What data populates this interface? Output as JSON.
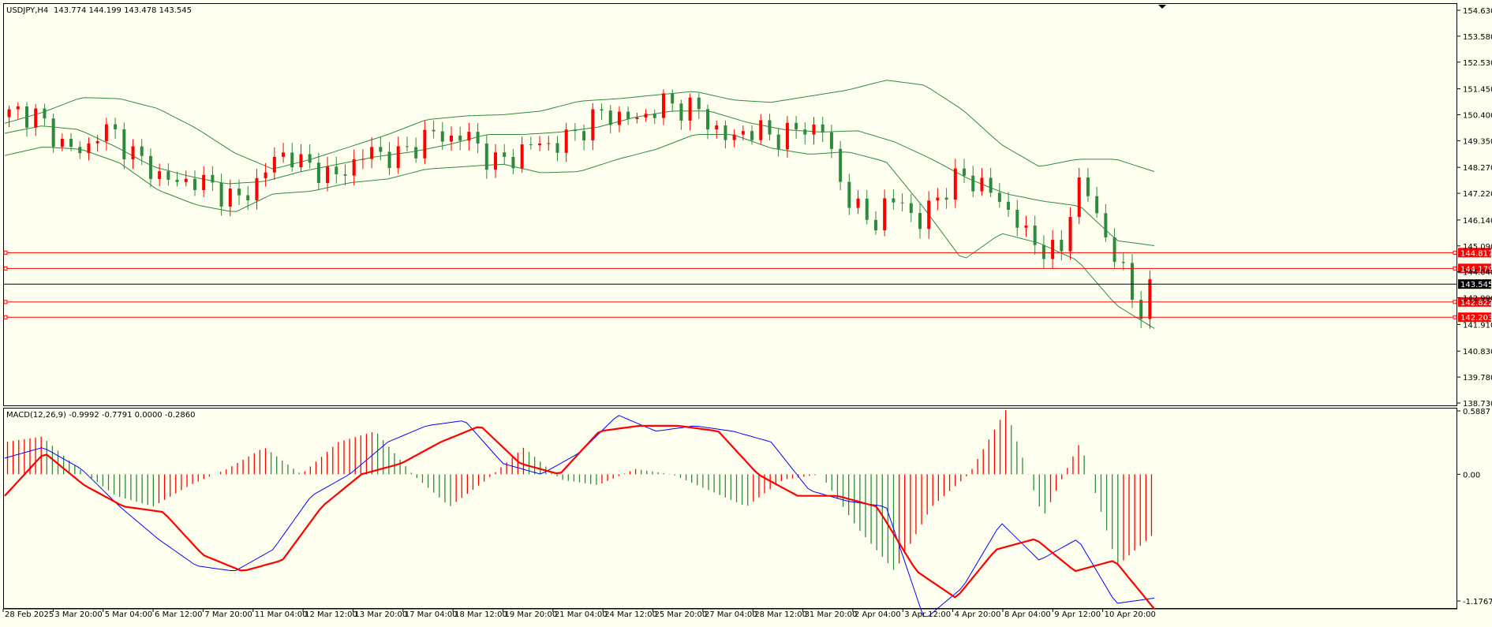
{
  "header": {
    "symbol": "USDJPY,H4",
    "ohlc": "143.774 144.199 143.478 143.545"
  },
  "macd_header": "MACD(12,26,9) -0.9992 -0.7791 0.0000 -0.2860",
  "colors": {
    "background": "#fffff0",
    "bull": "#ff0000",
    "bear": "#2e8b3e",
    "bands": "#2e8b3e",
    "macd_line": "#0000ff",
    "signal_line": "#ff0000",
    "level": "#ff0000",
    "price_line": "#000000"
  },
  "chart_data": [
    {
      "type": "candlestick",
      "symbol": "USDJPY",
      "timeframe": "H4",
      "ylim": [
        138.73,
        154.63
      ],
      "y_ticks": [
        "154.630",
        "153.580",
        "152.530",
        "151.450",
        "150.400",
        "149.350",
        "148.270",
        "147.220",
        "146.140",
        "145.090",
        "144.040",
        "142.990",
        "141.910",
        "140.830",
        "139.780",
        "138.730"
      ],
      "current_price": "143.545",
      "levels": [
        "144.817",
        "144.179",
        "142.822",
        "142.203"
      ],
      "x_labels": [
        "28 Feb 2025",
        "3 Mar 20:00",
        "5 Mar 04:00",
        "6 Mar 12:00",
        "7 Mar 20:00",
        "11 Mar 04:00",
        "12 Mar 12:00",
        "13 Mar 20:00",
        "17 Mar 04:00",
        "18 Mar 12:00",
        "19 Mar 20:00",
        "21 Mar 04:00",
        "24 Mar 12:00",
        "25 Mar 20:00",
        "27 Mar 04:00",
        "28 Mar 12:00",
        "31 Mar 20:00",
        "2 Apr 04:00",
        "3 Apr 12:00",
        "4 Apr 20:00",
        "8 Apr 04:00",
        "9 Apr 12:00",
        "10 Apr 20:00"
      ],
      "close_path": [
        150.3,
        150.55,
        150.35,
        149.6,
        149.1,
        148.8,
        149.8,
        149.6,
        148.9,
        148.3,
        147.9,
        147.6,
        147.8,
        147.5,
        147.2,
        146.9,
        147.7,
        148.5,
        148.9,
        148.3,
        148.2,
        147.8,
        148.4,
        148.9,
        148.8,
        148.7,
        149.1,
        149.7,
        149.4,
        149.6,
        149.2,
        148.4,
        148.6,
        149.0,
        149.3,
        149.1,
        149.6,
        150.0,
        150.5,
        150.3,
        150.2,
        150.5,
        150.9,
        150.7,
        150.6,
        149.9,
        149.3,
        149.8,
        149.7,
        149.5,
        149.7,
        149.9,
        149.8,
        147.8,
        146.6,
        146.0,
        146.7,
        147.0,
        145.8,
        147.0,
        147.5,
        148.0,
        147.5,
        147.1,
        146.3,
        145.4,
        145.0,
        144.6,
        147.7,
        147.0,
        145.3,
        144.0,
        142.4,
        143.5
      ],
      "bollinger": {
        "upper": [
          150.05,
          150.5,
          151.1,
          151.05,
          150.65,
          149.85,
          148.85,
          148.2,
          148.6,
          149.1,
          149.6,
          150.2,
          150.35,
          150.4,
          150.55,
          150.95,
          151.05,
          151.2,
          151.35,
          151.0,
          150.9,
          151.15,
          151.4,
          151.8,
          151.6,
          150.6,
          149.2,
          148.3,
          148.6,
          148.6,
          148.1
        ],
        "middle": [
          149.65,
          149.95,
          149.8,
          149.1,
          148.3,
          147.9,
          147.6,
          147.7,
          148.1,
          148.4,
          148.7,
          148.9,
          149.2,
          149.6,
          149.6,
          149.7,
          149.9,
          150.3,
          150.55,
          150.55,
          150.1,
          149.8,
          149.7,
          149.75,
          149.3,
          148.6,
          147.8,
          147.2,
          146.9,
          146.7,
          145.3,
          145.1
        ],
        "lower": [
          148.75,
          149.1,
          149.0,
          148.45,
          147.35,
          146.75,
          146.45,
          147.2,
          147.3,
          147.65,
          147.8,
          148.2,
          148.3,
          148.4,
          148.05,
          148.1,
          148.6,
          149.0,
          149.6,
          149.6,
          149.05,
          148.8,
          148.9,
          148.5,
          146.6,
          144.5,
          145.6,
          145.2,
          144.5,
          142.7,
          141.75
        ]
      },
      "candle_count": 130
    },
    {
      "type": "line",
      "title": "MACD(12,26,9)",
      "ylim": [
        -1.1767,
        0.5887
      ],
      "y_ticks": [
        "0.5887",
        "0.00",
        "-1.1767"
      ],
      "series": [
        {
          "name": "MACD",
          "values": [
            0.15,
            0.25,
            0.05,
            -0.3,
            -0.6,
            -0.85,
            -0.9,
            -0.7,
            -0.2,
            0.0,
            0.3,
            0.45,
            0.5,
            0.1,
            0.0,
            0.2,
            0.55,
            0.4,
            0.45,
            0.4,
            0.3,
            -0.15,
            -0.25,
            -0.3,
            -1.35,
            -1.05,
            -0.45,
            -0.8,
            -0.6,
            -1.2,
            -1.15
          ]
        },
        {
          "name": "Signal",
          "values": [
            -0.2,
            0.2,
            -0.1,
            -0.3,
            -0.35,
            -0.75,
            -0.9,
            -0.8,
            -0.3,
            0.0,
            0.1,
            0.3,
            0.45,
            0.1,
            0.0,
            0.4,
            0.45,
            0.45,
            0.4,
            0.0,
            -0.2,
            -0.2,
            -0.3,
            -0.9,
            -1.15,
            -0.7,
            -0.6,
            -0.9,
            -0.8,
            -1.25
          ]
        },
        {
          "name": "Histogram",
          "values": [
            0.3,
            0.35,
            0.05,
            -0.2,
            -0.3,
            -0.1,
            0.05,
            0.25,
            0.0,
            0.3,
            0.4,
            0.0,
            -0.3,
            -0.05,
            0.25,
            -0.05,
            -0.1,
            0.05,
            0.0,
            -0.15,
            -0.3,
            -0.05,
            0.0,
            -0.5,
            -0.9,
            -0.3,
            0.0,
            0.6,
            -0.4,
            0.3,
            -0.85,
            -0.55
          ]
        }
      ]
    }
  ]
}
